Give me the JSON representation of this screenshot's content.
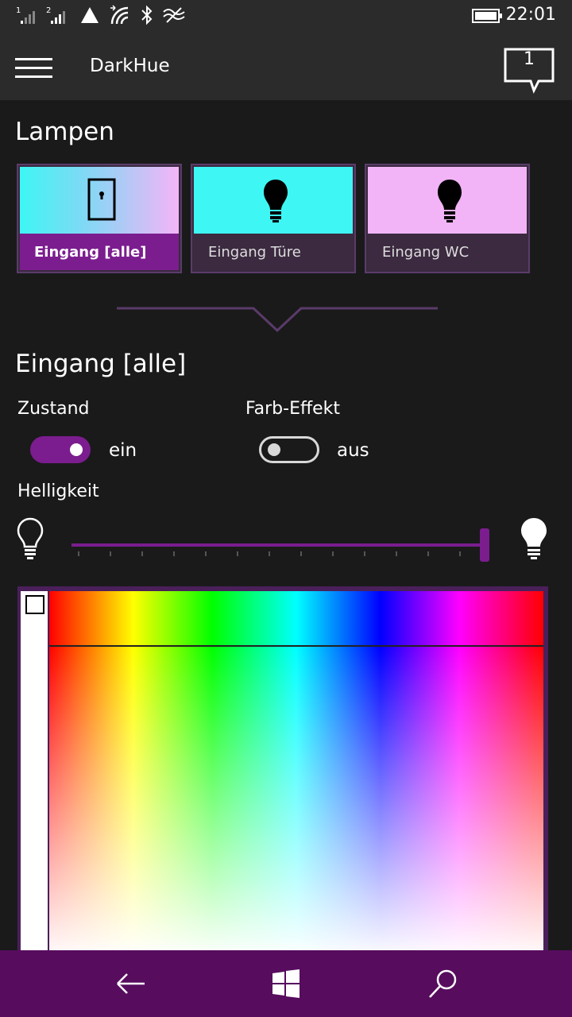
{
  "status_bar": {
    "time": "22:01",
    "signal1": "1",
    "signal2": "2",
    "icons": [
      "signal-1-icon",
      "signal-2-icon",
      "warning-icon",
      "wifi-icon",
      "bluetooth-icon",
      "data-sense-icon",
      "battery-icon"
    ]
  },
  "app_bar": {
    "title": "DarkHue",
    "notification_count": "1"
  },
  "lamps": {
    "heading": "Lampen",
    "tiles": [
      {
        "label": "Eingang [alle]",
        "icon": "door-icon",
        "active": true
      },
      {
        "label": "Eingang Türe",
        "icon": "bulb-icon",
        "active": false
      },
      {
        "label": "Eingang WC",
        "icon": "bulb-icon",
        "active": false
      }
    ]
  },
  "detail": {
    "heading": "Eingang [alle]",
    "state_label": "Zustand",
    "state_value": "ein",
    "state_on": true,
    "effect_label": "Farb-Effekt",
    "effect_value": "aus",
    "effect_on": false,
    "brightness_label": "Helligkeit",
    "brightness_level": 1.0
  },
  "colors": {
    "accent": "#7b1d8f",
    "nav_bar": "#570c5e",
    "background": "#1a1a1a"
  }
}
